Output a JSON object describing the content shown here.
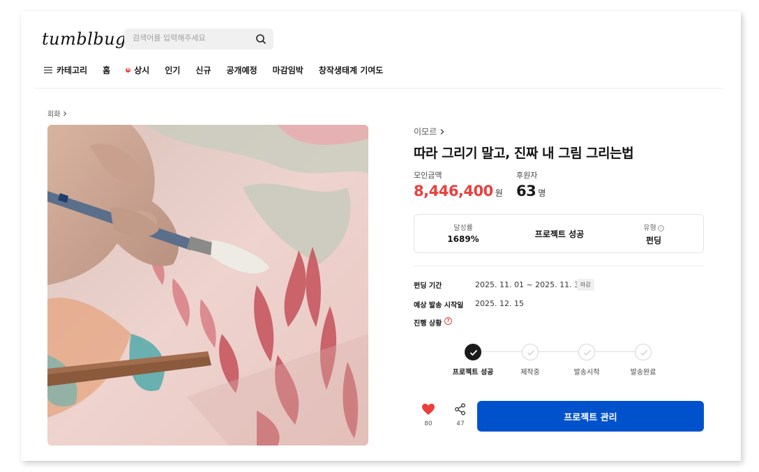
{
  "header": {
    "logo": "tumblbug",
    "search_placeholder": "검색어를 입력해주세요"
  },
  "nav": {
    "items": [
      "카테고리",
      "홈",
      "상시",
      "인기",
      "신규",
      "공개예정",
      "마감임박",
      "창작생태계 기여도"
    ],
    "new_badge": "N"
  },
  "breadcrumb": {
    "category": "회화"
  },
  "project": {
    "creator": "이모르",
    "title": "따라 그리기 말고, 진짜 내 그림 그리는법",
    "amount_label": "모인금액",
    "amount_value": "8,446,400",
    "amount_unit": "원",
    "backers_label": "후원자",
    "backers_value": "63",
    "backers_unit": "명",
    "accent_color": "#e8403d"
  },
  "summary": {
    "rate_label": "달성률",
    "rate_value": "1689%",
    "status": "프로젝트 성공",
    "type_label": "유형",
    "type_value": "펀딩"
  },
  "details": {
    "period_label": "펀딩 기간",
    "period_value": "2025. 11. 01 ~ 2025. 11. 30",
    "deadline_badge": "마감",
    "ship_label": "예상 발송 시작일",
    "ship_value": "2025. 12. 15",
    "progress_label": "진행 상황",
    "help_mark": "?",
    "info_mark": "i"
  },
  "steps": {
    "labels": [
      "프로젝트 성공",
      "제작중",
      "발송시작",
      "발송완료"
    ],
    "completed": 1
  },
  "actions": {
    "likes": "80",
    "shares": "47",
    "cta_label": "프로젝트 관리",
    "cta_color": "#0052cc"
  }
}
